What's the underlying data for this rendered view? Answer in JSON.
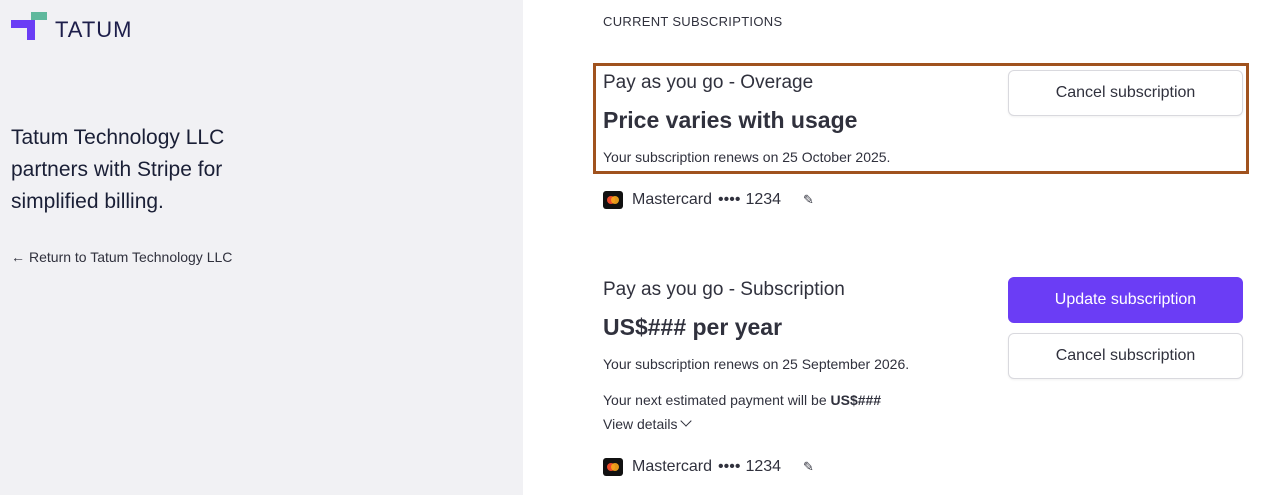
{
  "brand": {
    "logo_text": "TATUM",
    "accent": "#6b3df5",
    "green": "#5fb89c"
  },
  "left": {
    "tagline": "Tatum Technology LLC partners with Stripe for simplified billing.",
    "return_link": "Return to Tatum Technology LLC",
    "return_icon": "arrow-left-icon"
  },
  "section_title": "CURRENT SUBSCRIPTIONS",
  "subscriptions": [
    {
      "name": "Pay as you go - Overage",
      "price": "Price varies with usage",
      "renewal": "Your subscription renews on 25 October 2025.",
      "cancel_label": "Cancel subscription",
      "card_brand": "Mastercard",
      "card_dots": "••••",
      "card_last4": "1234"
    },
    {
      "name": "Pay as you go - Subscription",
      "price": "US$### per year",
      "renewal": "Your subscription renews on 25 September 2026.",
      "update_label": "Update subscription",
      "cancel_label": "Cancel subscription",
      "estimate_prefix": "Your next estimated payment will be",
      "estimate_amount": "US$###",
      "view_details": "View details",
      "card_brand": "Mastercard",
      "card_dots": "••••",
      "card_last4": "1234"
    }
  ],
  "highlight_color": "#a0521e"
}
